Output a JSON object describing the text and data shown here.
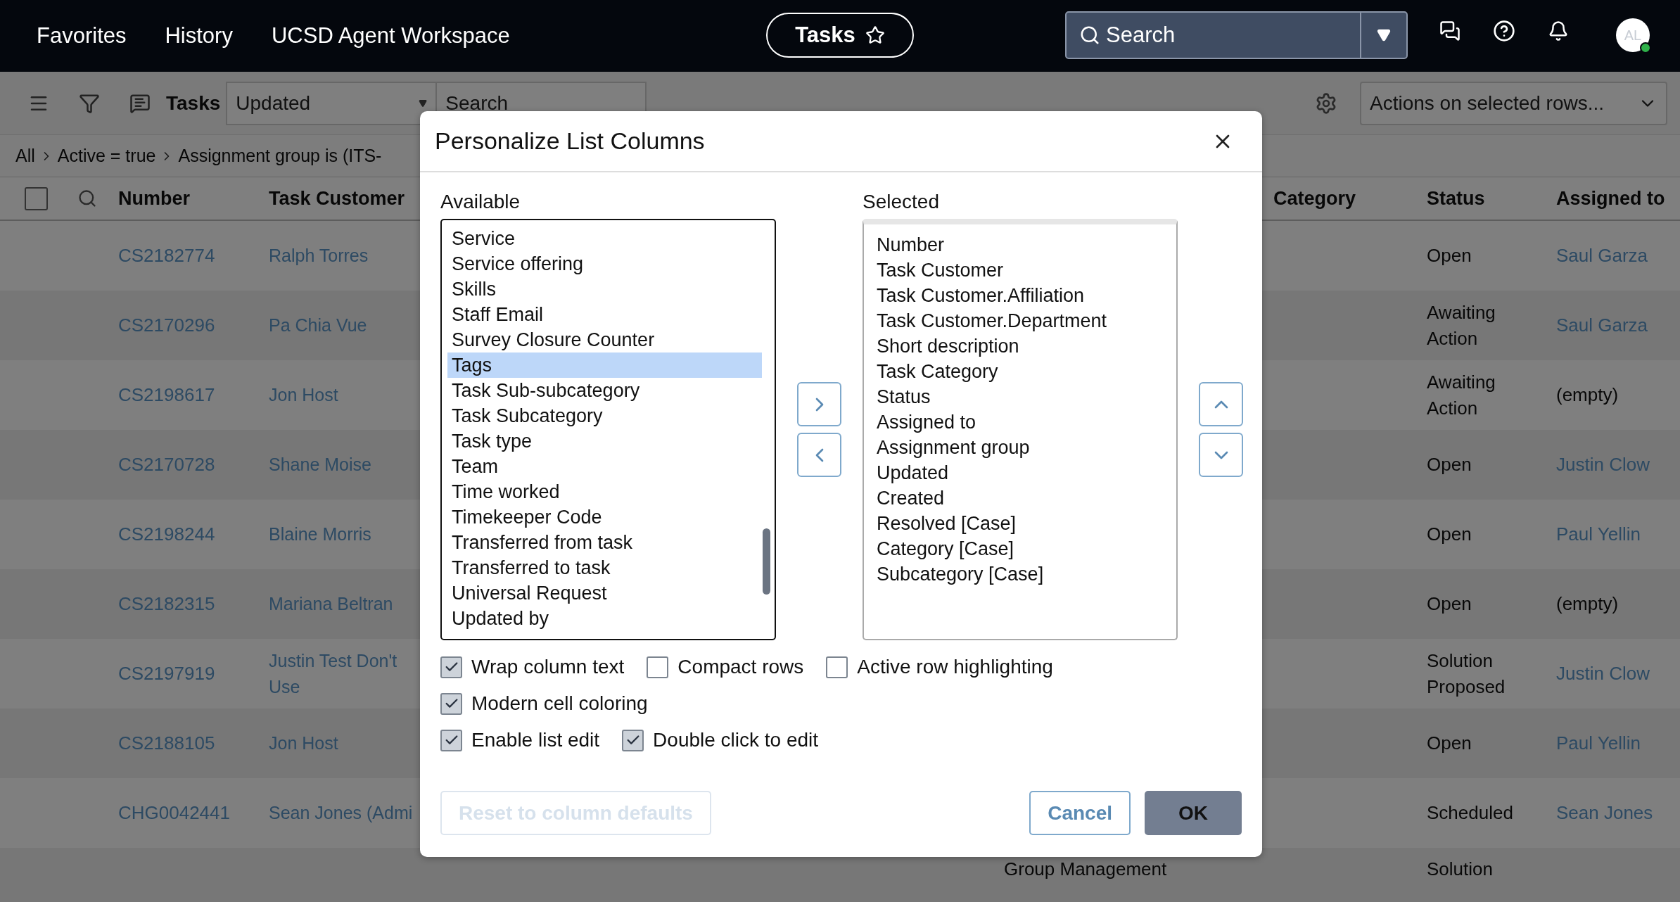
{
  "nav": {
    "links": [
      "Favorites",
      "History",
      "UCSD Agent Workspace"
    ],
    "tasks_button": "Tasks",
    "search": {
      "placeholder": "Search"
    },
    "avatar": {
      "initials": "AL",
      "online": true
    }
  },
  "toolbar": {
    "title": "Tasks",
    "sort_select": "Updated",
    "search": {
      "placeholder": "Search"
    },
    "actions_select": "Actions on selected rows..."
  },
  "breadcrumb": [
    "All",
    "Active = true",
    "Assignment group is (ITS-"
  ],
  "table": {
    "select_all": {
      "checked": false
    },
    "columns": [
      "Number",
      "Task Customer",
      "Category",
      "Status",
      "Assigned to"
    ],
    "rows": [
      {
        "number": "CS2182774",
        "customer": "Ralph Torres",
        "status": "Open",
        "assigned": "Saul Garza",
        "assigned_link": true
      },
      {
        "number": "CS2170296",
        "customer": "Pa Chia Vue",
        "status": "Awaiting Action",
        "assigned": "Saul Garza",
        "assigned_link": true
      },
      {
        "number": "CS2198617",
        "customer": "Jon Host",
        "status": "Awaiting Action",
        "assigned": "(empty)",
        "assigned_link": false
      },
      {
        "number": "CS2170728",
        "customer": "Shane Moise",
        "status": "Open",
        "assigned": "Justin Clow",
        "assigned_link": true
      },
      {
        "number": "CS2198244",
        "customer": "Blaine Morris",
        "status": "Open",
        "assigned": "Paul Yellin",
        "assigned_link": true
      },
      {
        "number": "CS2182315",
        "customer": "Mariana Beltran",
        "status": "Open",
        "assigned": "(empty)",
        "assigned_link": false
      },
      {
        "number": "CS2197919",
        "customer": "Justin Test Don't Use",
        "status": "Solution Proposed",
        "assigned": "Justin Clow",
        "assigned_link": true
      },
      {
        "number": "CS2188105",
        "customer": "Jon Host",
        "status": "Open",
        "assigned": "Paul Yellin",
        "assigned_link": true
      },
      {
        "number": "CHG0042441",
        "customer": "Sean Jones (Admi",
        "status": "Scheduled",
        "assigned": "Sean Jones",
        "assigned_link": true
      },
      {
        "group": "Group Management",
        "status": "Solution"
      }
    ]
  },
  "dialog": {
    "title": "Personalize List Columns",
    "available_label": "Available",
    "selected_label": "Selected",
    "available": [
      {
        "label": "Service",
        "selected": false
      },
      {
        "label": "Service offering",
        "selected": false
      },
      {
        "label": "Skills",
        "selected": false
      },
      {
        "label": "Staff Email",
        "selected": false
      },
      {
        "label": "Survey Closure Counter",
        "selected": false
      },
      {
        "label": "Tags",
        "selected": true
      },
      {
        "label": "Task Sub-subcategory",
        "selected": false
      },
      {
        "label": "Task Subcategory",
        "selected": false
      },
      {
        "label": "Task type",
        "selected": false
      },
      {
        "label": "Team",
        "selected": false
      },
      {
        "label": "Time worked",
        "selected": false
      },
      {
        "label": "Timekeeper Code",
        "selected": false
      },
      {
        "label": "Transferred from task",
        "selected": false
      },
      {
        "label": "Transferred to task",
        "selected": false
      },
      {
        "label": "Universal Request",
        "selected": false
      },
      {
        "label": "Updated by",
        "selected": false
      }
    ],
    "selected": [
      "Number",
      "Task Customer",
      "Task Customer.Affiliation",
      "Task Customer.Department",
      "Short description",
      "Task Category",
      "Status",
      "Assigned to",
      "Assignment group",
      "Updated",
      "Created",
      "Resolved [Case]",
      "Category [Case]",
      "Subcategory [Case]"
    ],
    "options": [
      [
        {
          "label": "Wrap column text",
          "checked": true
        },
        {
          "label": "Compact rows",
          "checked": false
        },
        {
          "label": "Active row highlighting",
          "checked": false
        }
      ],
      [
        {
          "label": "Modern cell coloring",
          "checked": true
        }
      ],
      [
        {
          "label": "Enable list edit",
          "checked": true
        },
        {
          "label": "Double click to edit",
          "checked": true
        }
      ]
    ],
    "buttons": [
      {
        "label": "Reset to column defaults",
        "kind": "secondary",
        "disabled": true
      },
      {
        "label": "Cancel",
        "kind": "secondary",
        "disabled": false
      },
      {
        "label": "OK",
        "kind": "primary",
        "disabled": false
      }
    ]
  }
}
